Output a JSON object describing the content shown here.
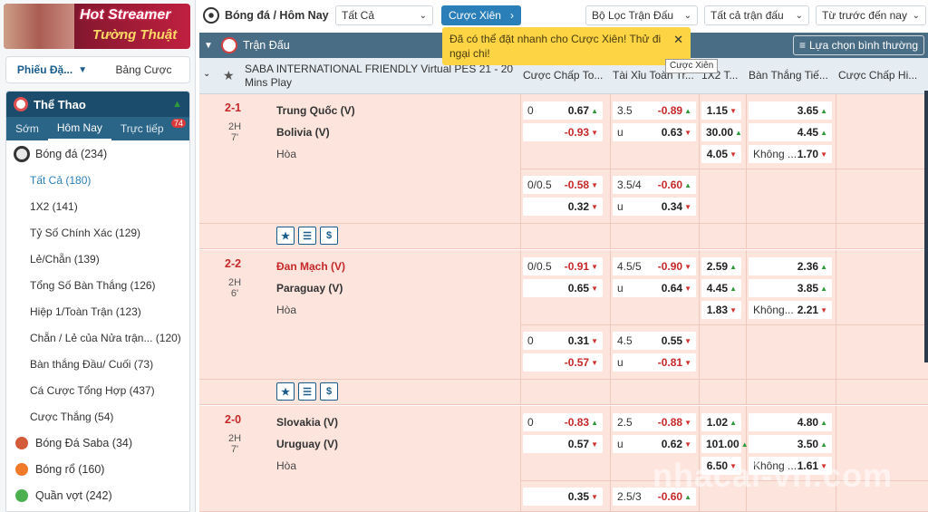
{
  "banner": {
    "line1": "Hot Streamer",
    "line2": "Tường Thuật"
  },
  "sidebar": {
    "tabs": [
      {
        "label": "Phiếu Đặ..."
      },
      {
        "label": "Bảng Cược"
      }
    ],
    "sport_header": "Thể Thao",
    "time_tabs": [
      {
        "label": "Sớm"
      },
      {
        "label": "Hôm Nay"
      },
      {
        "label": "Trực tiếp"
      }
    ],
    "live_count": "74",
    "items": [
      {
        "label": "Bóng đá (234)",
        "type": "sport"
      },
      {
        "label": "Tất Cả (180)",
        "type": "sub",
        "active": true
      },
      {
        "label": "1X2 (141)",
        "type": "sub"
      },
      {
        "label": "Tỷ Số Chính Xác (129)",
        "type": "sub"
      },
      {
        "label": "Lẻ/Chẵn (139)",
        "type": "sub"
      },
      {
        "label": "Tổng Số Bàn Thắng (126)",
        "type": "sub"
      },
      {
        "label": "Hiệp 1/Toàn Trận (123)",
        "type": "sub"
      },
      {
        "label": "Chẵn / Lẻ của Nửa trận... (120)",
        "type": "sub"
      },
      {
        "label": "Bàn thắng Đầu/ Cuối (73)",
        "type": "sub"
      },
      {
        "label": "Cá Cược Tổng Hợp (437)",
        "type": "sub"
      },
      {
        "label": "Cược Thắng (54)",
        "type": "sub"
      },
      {
        "label": "Bóng Đá Saba (34)",
        "type": "sport"
      },
      {
        "label": "Bóng rổ (160)",
        "type": "sport"
      },
      {
        "label": "Quần vợt (242)",
        "type": "sport"
      }
    ]
  },
  "topbar": {
    "title": "Bóng đá / Hôm Nay",
    "select_all": "Tất Cả",
    "parlay": "Cược Xiên",
    "filter": "Bộ Lọc Trận Đấu",
    "all_matches": "Tất cả trận đấu",
    "sort": "Từ trước đến nay"
  },
  "main_header": {
    "label": "Trận Đấu",
    "pick": "Lựa chọn bình thường"
  },
  "toast": {
    "text": "Đã có thể đặt nhanh cho Cược Xiên! Thử đi ngại chi!"
  },
  "tooltip": "Cược Xiên",
  "league": "SABA INTERNATIONAL FRIENDLY Virtual PES 21 - 20 Mins Play",
  "columns": [
    "Cược Chấp To...",
    "Tài Xỉu Toàn Tr...",
    "1X2 T...",
    "Bàn Thắng Tiế...",
    "Cược Chấp Hi..."
  ],
  "matches": [
    {
      "score": "2-1",
      "period": "2H",
      "minute": "7'",
      "home": "Trung Quốc (V)",
      "away": "Bolivia (V)",
      "draw": "Hòa",
      "row1": {
        "hcp": "0",
        "hcp_home": "0.67",
        "ou": "3.5",
        "ou_over": "-0.89",
        "x12": "1.15",
        "next": "3.65"
      },
      "row2": {
        "hcp_away": "-0.93",
        "ou_u": "u",
        "ou_under": "0.63",
        "x12": "30.00",
        "next": "4.45"
      },
      "row3": {
        "x12": "4.05",
        "next_lbl": "Không ...",
        "next": "1.70"
      },
      "row4": {
        "hcp": "0/0.5",
        "hcp_home": "-0.58",
        "ou": "3.5/4",
        "ou_over": "-0.60"
      },
      "row5": {
        "hcp_away": "0.32",
        "ou_u": "u",
        "ou_under": "0.34"
      }
    },
    {
      "score": "2-2",
      "period": "2H",
      "minute": "6'",
      "home": "Đan Mạch (V)",
      "away": "Paraguay (V)",
      "draw": "Hòa",
      "row1": {
        "hcp": "0/0.5",
        "hcp_home": "-0.91",
        "ou": "4.5/5",
        "ou_over": "-0.90",
        "x12": "2.59",
        "next": "2.36"
      },
      "row2": {
        "hcp_away": "0.65",
        "ou_u": "u",
        "ou_under": "0.64",
        "x12": "4.45",
        "next": "3.85"
      },
      "row3": {
        "x12": "1.83",
        "next_lbl": "Không...",
        "next": "2.21"
      },
      "row4": {
        "hcp": "0",
        "hcp_home": "0.31",
        "ou": "4.5",
        "ou_over": "0.55"
      },
      "row5": {
        "hcp_away": "-0.57",
        "ou_u": "u",
        "ou_under": "-0.81"
      }
    },
    {
      "score": "2-0",
      "period": "2H",
      "minute": "7'",
      "home": "Slovakia (V)",
      "away": "Uruguay (V)",
      "draw": "Hòa",
      "row1": {
        "hcp": "0",
        "hcp_home": "-0.83",
        "ou": "2.5",
        "ou_over": "-0.88",
        "x12": "1.02",
        "next": "4.80"
      },
      "row2": {
        "hcp_away": "0.57",
        "ou_u": "u",
        "ou_under": "0.62",
        "x12": "101.00",
        "next": "3.50"
      },
      "row3": {
        "x12": "6.50",
        "next_lbl": "Không ...",
        "next": "1.61"
      },
      "row4": {
        "hcp_home": "0.35",
        "ou": "2.5/3",
        "ou_over": "-0.60"
      }
    }
  ],
  "watermark": "nhacai-vn.com"
}
